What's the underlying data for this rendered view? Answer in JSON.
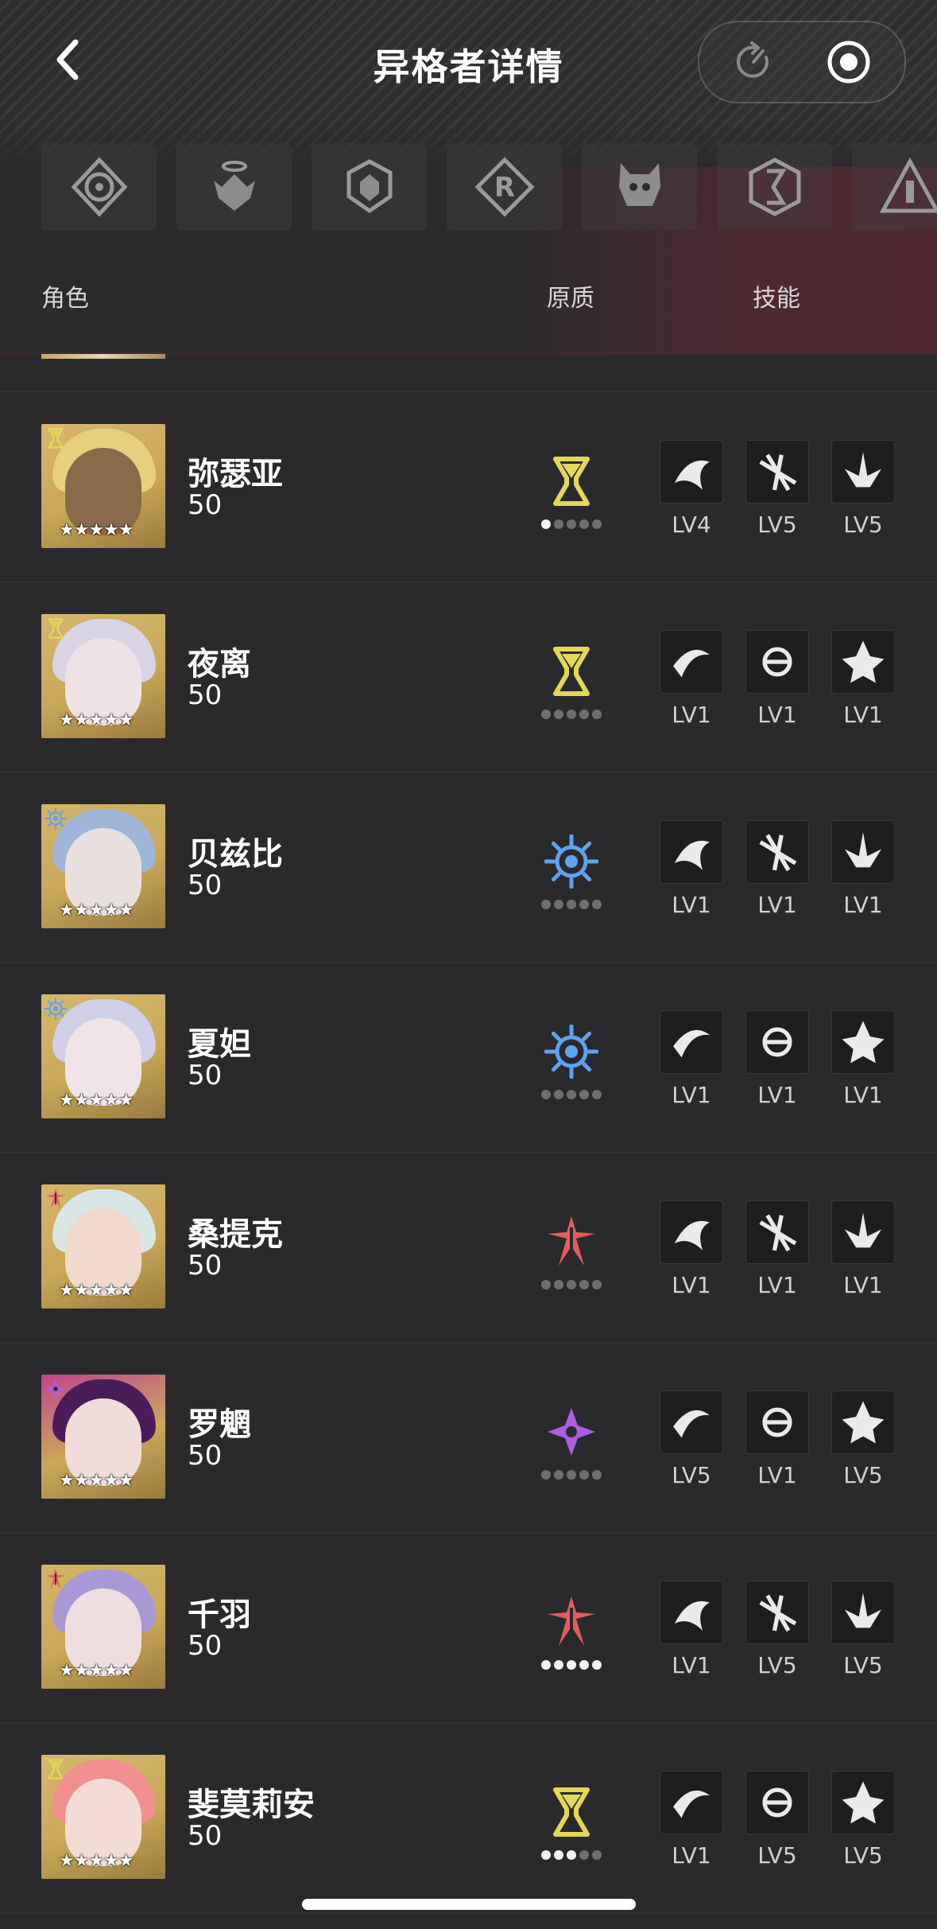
{
  "header": {
    "title": "异格者详情",
    "back_icon": "chevron-left-icon",
    "refresh_icon": "refresh-icon",
    "record_icon": "record-icon"
  },
  "filters": [
    {
      "icon": "faction-star-emblem-icon"
    },
    {
      "icon": "faction-wings-emblem-icon"
    },
    {
      "icon": "faction-crown-emblem-icon"
    },
    {
      "icon": "faction-r-emblem-icon"
    },
    {
      "icon": "faction-beast-mask-icon"
    },
    {
      "icon": "faction-hex-emblem-icon"
    },
    {
      "icon": "faction-triangle-emblem-icon"
    }
  ],
  "columns": {
    "role": "角色",
    "origin": "原质",
    "skills": "技能"
  },
  "colors": {
    "gold": "#e4d65a",
    "blue": "#5fa2ef",
    "red": "#e45c5e",
    "purple": "#b25ce3"
  },
  "characters": [
    {
      "name": "弥瑟亚",
      "level": "50",
      "element": "gold",
      "dots_on": 1,
      "skills": [
        "LV4",
        "LV5",
        "LV5"
      ],
      "portrait": {
        "bg": "#d8b76a",
        "hair": "#e6cf7d",
        "face": "#8a6a4b"
      }
    },
    {
      "name": "夜离",
      "level": "50",
      "element": "gold",
      "dots_on": 0,
      "skills": [
        "LV1",
        "LV1",
        "LV1"
      ],
      "portrait": {
        "bg": "#d4b66c",
        "hair": "#d8d4e6",
        "face": "#efe2e6"
      }
    },
    {
      "name": "贝兹比",
      "level": "50",
      "element": "blue",
      "dots_on": 0,
      "skills": [
        "LV1",
        "LV1",
        "LV1"
      ],
      "portrait": {
        "bg": "#d2b46a",
        "hair": "#9fb6d8",
        "face": "#eadfdf"
      }
    },
    {
      "name": "夏妲",
      "level": "50",
      "element": "blue",
      "dots_on": 0,
      "skills": [
        "LV1",
        "LV1",
        "LV1"
      ],
      "portrait": {
        "bg": "#d6b870",
        "hair": "#cfd0e8",
        "face": "#f0e4e8"
      }
    },
    {
      "name": "桑提克",
      "level": "50",
      "element": "red",
      "dots_on": 0,
      "skills": [
        "LV1",
        "LV1",
        "LV1"
      ],
      "portrait": {
        "bg": "#d4b56a",
        "hair": "#d9e6e6",
        "face": "#f0d9cd"
      }
    },
    {
      "name": "罗魍",
      "level": "50",
      "element": "purple",
      "dots_on": 0,
      "skills": [
        "LV5",
        "LV1",
        "LV5"
      ],
      "portrait": {
        "bg": "#c0448e",
        "hair": "#4a1d5a",
        "face": "#f0dcd8"
      }
    },
    {
      "name": "千羽",
      "level": "50",
      "element": "red",
      "dots_on": 5,
      "skills": [
        "LV1",
        "LV5",
        "LV5"
      ],
      "portrait": {
        "bg": "#d2b46a",
        "hair": "#a899d6",
        "face": "#efdedf"
      }
    },
    {
      "name": "斐莫莉安",
      "level": "50",
      "element": "gold",
      "dots_on": 3,
      "skills": [
        "LV1",
        "LV5",
        "LV5"
      ],
      "portrait": {
        "bg": "#d6b86e",
        "hair": "#f2908f",
        "face": "#f3dcd6"
      }
    }
  ]
}
